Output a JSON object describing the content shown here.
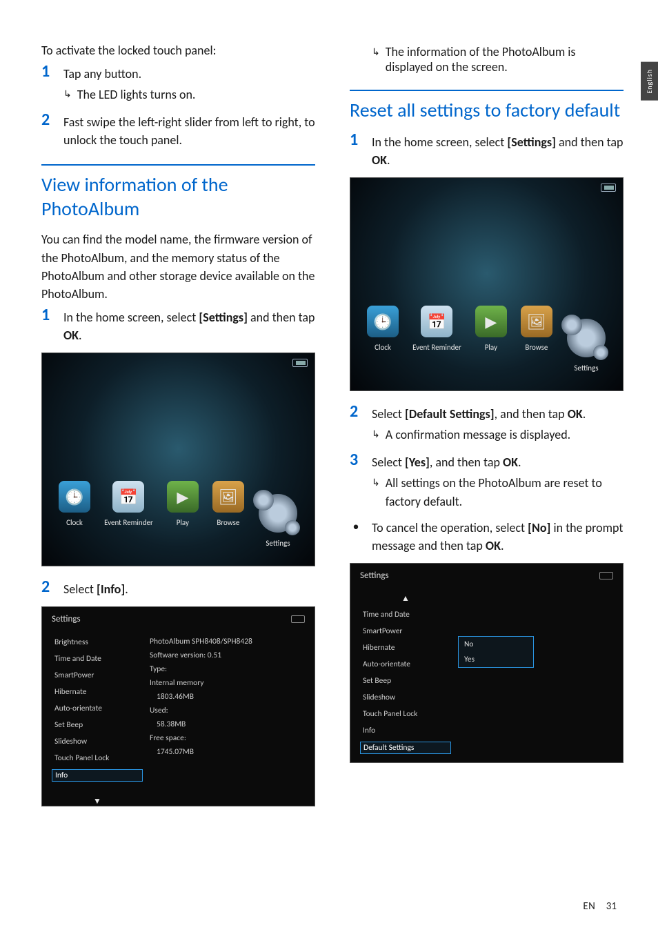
{
  "sideTab": "English",
  "footer": {
    "langCode": "EN",
    "pageNum": "31"
  },
  "left": {
    "intro": "To activate the locked touch panel:",
    "step1": {
      "text": "Tap any button.",
      "sub": "The LED lights turns on."
    },
    "step2": {
      "text": "Fast swipe the left-right slider from left to right, to unlock the touch panel."
    },
    "sectionA_title": "View information of the PhotoAlbum",
    "sectionA_para": "You can find the model name, the firmware version of the PhotoAlbum, and the memory status of the PhotoAlbum and other storage device available on the PhotoAlbum.",
    "sectionA_step1": {
      "pre": "In the home screen, select ",
      "bold": "[Settings]",
      "post": " and then tap ",
      "ok": "OK",
      "end": "."
    },
    "sectionA_step2": {
      "pre": "Select ",
      "bold": "[Info]",
      "end": "."
    },
    "home": {
      "items": [
        "Clock",
        "Event Reminder",
        "Play",
        "Browse",
        "Settings"
      ]
    },
    "infoPanel": {
      "title": "Settings",
      "menu": [
        "Brightness",
        "Time and Date",
        "SmartPower",
        "Hibernate",
        "Auto-orientate",
        "Set Beep",
        "Slideshow",
        "Touch Panel Lock",
        "Info"
      ],
      "selected": "Info",
      "detail": {
        "l1": "PhotoAlbum SPH8408/SPH8428",
        "l2": "Software version: 0.51",
        "l3": "Type:",
        "l4": "Internal memory",
        "l5": "1803.46MB",
        "l6": "Used:",
        "l7": "58.38MB",
        "l8": "Free space:",
        "l9": "1745.07MB"
      }
    }
  },
  "right": {
    "topSub": "The information of the PhotoAlbum is displayed on the screen.",
    "sectionB_title": "Reset all settings to factory default",
    "sectionB_step1": {
      "pre": "In the home screen, select ",
      "bold": "[Settings]",
      "post": " and then tap ",
      "ok": "OK",
      "end": "."
    },
    "home": {
      "items": [
        "Clock",
        "Event Reminder",
        "Play",
        "Browse",
        "Settings"
      ]
    },
    "sectionB_step2": {
      "pre": "Select ",
      "bold": "[Default Settings]",
      "post": ", and then tap ",
      "ok": "OK",
      "end": ".",
      "sub": "A confirmation message is displayed."
    },
    "sectionB_step3": {
      "pre": "Select ",
      "bold": "[Yes]",
      "post": ", and then tap ",
      "ok": "OK",
      "end": ".",
      "sub": "All settings on the PhotoAlbum are reset to factory default."
    },
    "sectionB_bullet": {
      "pre": "To cancel the operation, select ",
      "bold": "[No]",
      "post": " in the prompt message and then tap ",
      "ok": "OK",
      "end": "."
    },
    "defaultsPanel": {
      "title": "Settings",
      "menu": [
        "Time and Date",
        "SmartPower",
        "Hibernate",
        "Auto-orientate",
        "Set Beep",
        "Slideshow",
        "Touch Panel Lock",
        "Info",
        "Default Settings"
      ],
      "selected": "Default Settings",
      "options": [
        "No",
        "Yes"
      ]
    }
  }
}
